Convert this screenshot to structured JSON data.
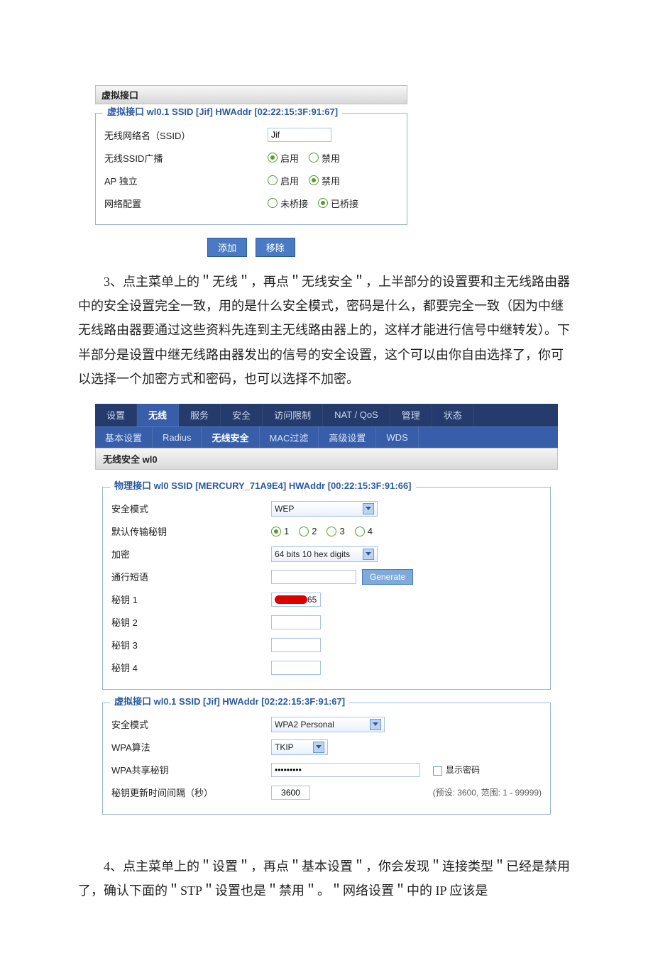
{
  "panel1": {
    "header": "虚拟接口",
    "legend": "虚拟接口  wl0.1 SSID [Jif] HWAddr [02:22:15:3F:91:67]",
    "rows": {
      "ssid_label": "无线网络名（SSID）",
      "ssid_value": "Jif",
      "broadcast_label": "无线SSID广播",
      "enable": "启用",
      "disable": "禁用",
      "apiso_label": "AP 独立",
      "netcfg_label": "网络配置",
      "unbridged": "未桥接",
      "bridged": "已桥接"
    },
    "add_btn": "添加",
    "remove_btn": "移除"
  },
  "para3": "　　3、点主菜单上的＂无线＂，再点＂无线安全＂，上半部分的设置要和主无线路由器中的安全设置完全一致，用的是什么安全模式，密码是什么，都要完全一致（因为中继无线路由器要通过这些资料先连到主无线路由器上的，这样才能进行信号中继转发）。下半部分是设置中继无线路由器发出的信号的安全设置，这个可以由你自由选择了，你可以选择一个加密方式和密码，也可以选择不加密。",
  "panel2": {
    "top_tabs": [
      "设置",
      "无线",
      "服务",
      "安全",
      "访问限制",
      "NAT / QoS",
      "管理",
      "状态"
    ],
    "top_active": 1,
    "sub_tabs": [
      "基本设置",
      "Radius",
      "无线安全",
      "MAC过滤",
      "高级设置",
      "WDS"
    ],
    "sub_bold": 2,
    "section_title": "无线安全  wl0",
    "phys": {
      "legend": "物理接口  wl0 SSID [MERCURY_71A9E4] HWAddr [00:22:15:3F:91:66]",
      "secmode_label": "安全模式",
      "secmode_value": "WEP",
      "defkey_label": "默认传输秘钥",
      "enc_label": "加密",
      "enc_value": "64 bits 10 hex digits",
      "pass_label": "通行短语",
      "generate": "Generate",
      "key1_label": "秘钥 1",
      "key1_value": "65",
      "key2_label": "秘钥 2",
      "key3_label": "秘钥 3",
      "key4_label": "秘钥 4"
    },
    "virt": {
      "legend": "虚拟接口  wl0.1 SSID [Jif] HWAddr [02:22:15:3F:91:67]",
      "secmode_label": "安全模式",
      "secmode_value": "WPA2 Personal",
      "wpaalg_label": "WPA算法",
      "wpaalg_value": "TKIP",
      "psk_label": "WPA共享秘钥",
      "psk_value": "•••••••••",
      "showpwd": "显示密码",
      "rekey_label": "秘钥更新时间间隔（秒）",
      "rekey_value": "3600",
      "rekey_hint": "(预设: 3600, 范围: 1 - 99999)"
    }
  },
  "para4": "　　4、点主菜单上的＂设置＂，再点＂基本设置＂，你会发现＂连接类型＂已经是禁用了，确认下面的＂STP＂设置也是＂禁用＂。＂网络设置＂中的 IP 应该是"
}
